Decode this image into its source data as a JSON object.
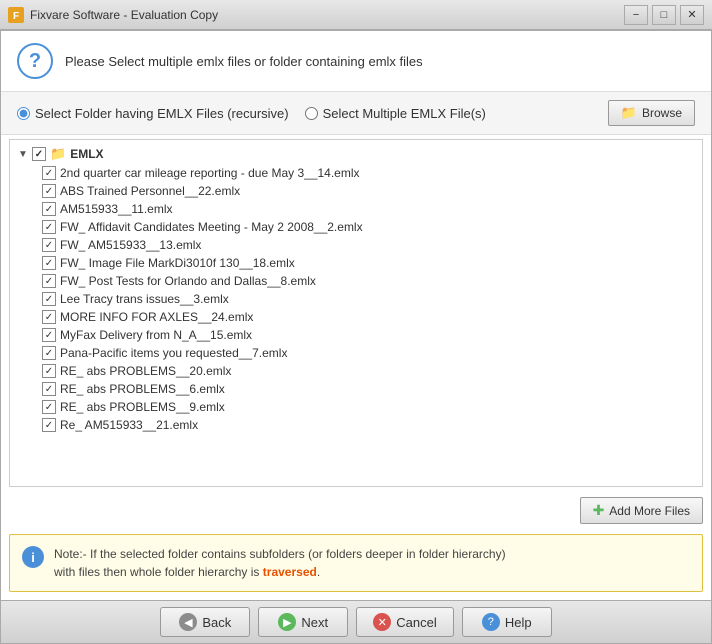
{
  "titleBar": {
    "appName": "Fixvare Software - Evaluation Copy",
    "minBtn": "−",
    "maxBtn": "□",
    "closeBtn": "✕"
  },
  "header": {
    "icon": "?",
    "text": "Please Select multiple emlx files or folder containing emlx files"
  },
  "radioRow": {
    "option1": {
      "label": "Select Folder having EMLX Files (recursive)",
      "checked": true
    },
    "option2": {
      "label": "Select Multiple EMLX File(s)",
      "checked": false
    },
    "browseBtn": "Browse"
  },
  "fileList": {
    "root": "EMLX",
    "items": [
      "2nd quarter car mileage reporting - due May 3__14.emlx",
      "ABS Trained Personnel__22.emlx",
      "AM515933__11.emlx",
      "FW_ Affidavit Candidates Meeting - May 2 2008__2.emlx",
      "FW_ AM515933__13.emlx",
      "FW_ Image File MarkDi3010f 130__18.emlx",
      "FW_ Post Tests for Orlando and Dallas__8.emlx",
      "Lee Tracy trans issues__3.emlx",
      "MORE INFO FOR AXLES__24.emlx",
      "MyFax Delivery from N_A__15.emlx",
      "Pana-Pacific items you requested__7.emlx",
      "RE_ abs PROBLEMS__20.emlx",
      "RE_ abs PROBLEMS__6.emlx",
      "RE_ abs PROBLEMS__9.emlx",
      "Re_ AM515933__21.emlx"
    ]
  },
  "addMoreFiles": {
    "label": "Add More Files"
  },
  "note": {
    "prefix": "Note:- If the selected folder contains subfolders (or folders deeper in folder hierarchy)",
    "suffix": "with files then whole folder hierarchy is",
    "highlight": "traversed",
    "end": "."
  },
  "footer": {
    "backBtn": "Back",
    "nextBtn": "Next",
    "cancelBtn": "Cancel",
    "helpBtn": "Help"
  }
}
